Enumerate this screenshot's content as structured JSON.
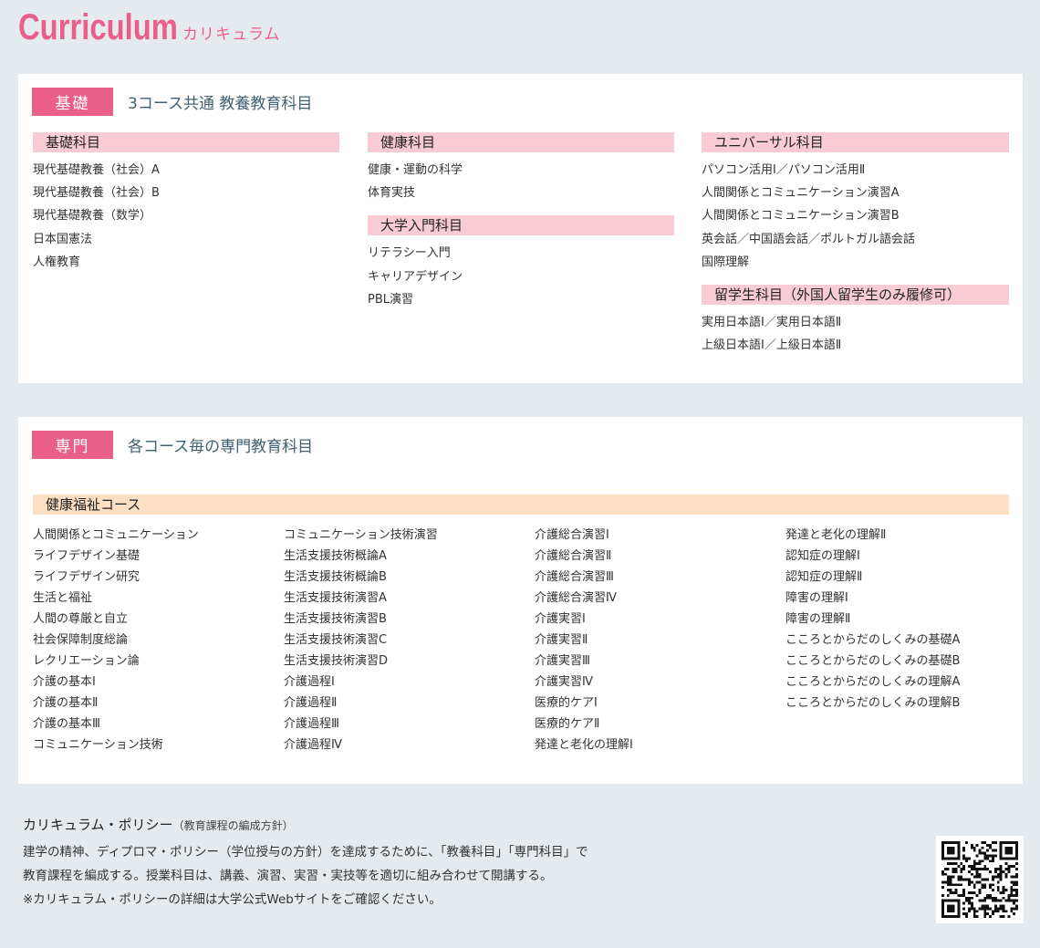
{
  "header": {
    "title_en": "Curriculum",
    "title_jp": "カリキュラム"
  },
  "basic": {
    "tag": "基礎",
    "title": "3コース共通 教養教育科目",
    "col1": {
      "heading": "基礎科目",
      "items": [
        "現代基礎教養（社会）A",
        "現代基礎教養（社会）B",
        "現代基礎教養（数学）",
        "日本国憲法",
        "人権教育"
      ]
    },
    "col2a": {
      "heading": "健康科目",
      "items": [
        "健康・運動の科学",
        "体育実技"
      ]
    },
    "col2b": {
      "heading": "大学入門科目",
      "items": [
        "リテラシー入門",
        "キャリアデザイン",
        "PBL演習"
      ]
    },
    "col3a": {
      "heading": "ユニバーサル科目",
      "items": [
        "パソコン活用Ⅰ／パソコン活用Ⅱ",
        "人間関係とコミュニケーション演習A",
        "人間関係とコミュニケーション演習B",
        "英会話／中国語会話／ポルトガル語会話",
        "国際理解"
      ]
    },
    "col3b": {
      "heading": "留学生科目（外国人留学生のみ履修可）",
      "items": [
        "実用日本語Ⅰ／実用日本語Ⅱ",
        "上級日本語Ⅰ／上級日本語Ⅱ"
      ]
    }
  },
  "senmon": {
    "tag": "専門",
    "title": "各コース毎の専門教育科目",
    "course": "健康福祉コース",
    "col1": [
      "人間関係とコミュニケーション",
      "ライフデザイン基礎",
      "ライフデザイン研究",
      "生活と福祉",
      "人間の尊厳と自立",
      "社会保障制度総論",
      "レクリエーション論",
      "介護の基本Ⅰ",
      "介護の基本Ⅱ",
      "介護の基本Ⅲ",
      "コミュニケーション技術"
    ],
    "col2": [
      "コミュニケーション技術演習",
      "生活支援技術概論A",
      "生活支援技術概論B",
      "生活支援技術演習A",
      "生活支援技術演習B",
      "生活支援技術演習C",
      "生活支援技術演習D",
      "介護過程Ⅰ",
      "介護過程Ⅱ",
      "介護過程Ⅲ",
      "介護過程Ⅳ"
    ],
    "col3": [
      "介護総合演習Ⅰ",
      "介護総合演習Ⅱ",
      "介護総合演習Ⅲ",
      "介護総合演習Ⅳ",
      "介護実習Ⅰ",
      "介護実習Ⅱ",
      "介護実習Ⅲ",
      "介護実習Ⅳ",
      "医療的ケアⅠ",
      "医療的ケアⅡ",
      "発達と老化の理解Ⅰ"
    ],
    "col4": [
      "発達と老化の理解Ⅱ",
      "認知症の理解Ⅰ",
      "認知症の理解Ⅱ",
      "障害の理解Ⅰ",
      "障害の理解Ⅱ",
      "こころとからだのしくみの基礎A",
      "こころとからだのしくみの基礎B",
      "こころとからだのしくみの理解A",
      "こころとからだのしくみの理解B"
    ]
  },
  "policy": {
    "title": "カリキュラム・ポリシー",
    "subtitle": "（教育課程の編成方針）",
    "lines": [
      "建学の精神、ディプロマ・ポリシー（学位授与の方針）を達成するために、「教養科目」「専門科目」で",
      "教育課程を編成する。授業科目は、講義、演習、実習・実技等を適切に組み合わせて開講する。",
      "※カリキュラム・ポリシーの詳細は大学公式Webサイトをご確認ください。"
    ]
  },
  "qr": {
    "icon": "qr-code-icon"
  }
}
